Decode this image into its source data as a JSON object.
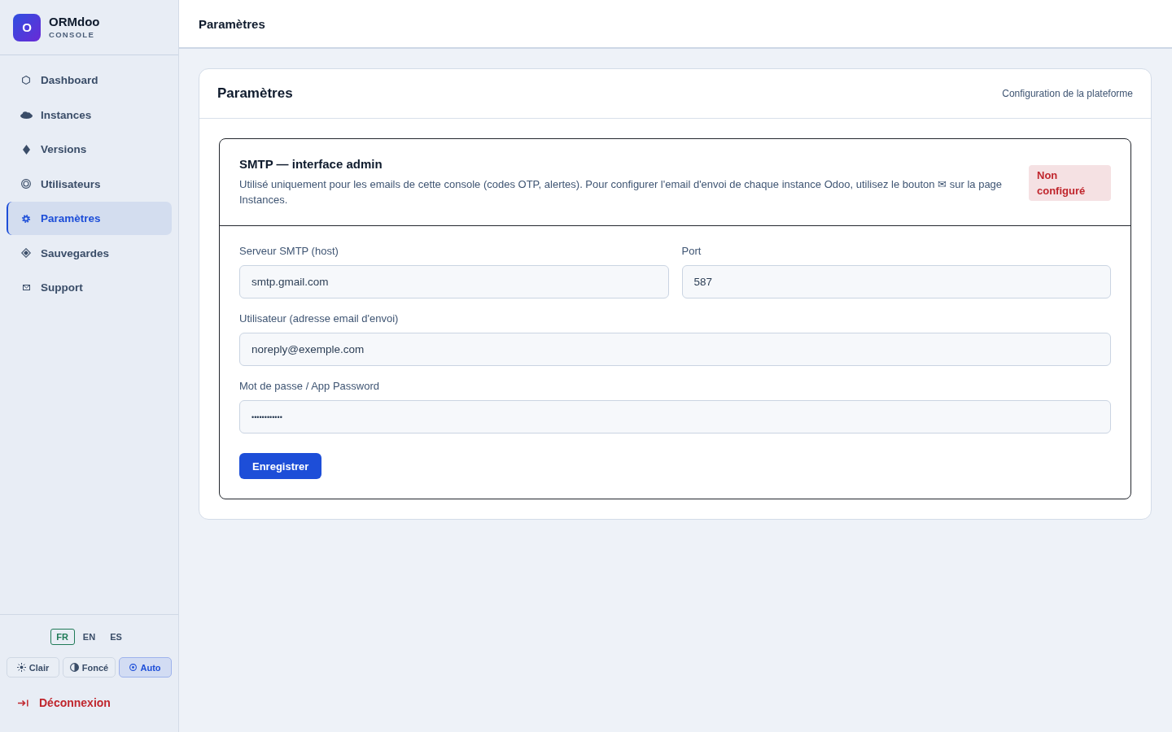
{
  "sidebar": {
    "brand": {
      "logo_letter": "O",
      "name": "ORMdoo",
      "subtitle": "CONSOLE"
    },
    "items": [
      {
        "label": "Dashboard",
        "selected": false
      },
      {
        "label": "Instances",
        "selected": false
      },
      {
        "label": "Versions",
        "selected": false
      },
      {
        "label": "Utilisateurs",
        "selected": false
      },
      {
        "label": "Paramètres",
        "selected": true
      },
      {
        "label": "Sauvegardes",
        "selected": false
      },
      {
        "label": "Support",
        "selected": false
      }
    ],
    "languages": [
      {
        "label": "FR",
        "selected": true
      },
      {
        "label": "EN",
        "selected": false
      },
      {
        "label": "ES",
        "selected": false
      }
    ],
    "themes": [
      {
        "label": "Clair",
        "selected": false
      },
      {
        "label": "Foncé",
        "selected": false
      },
      {
        "label": "Auto",
        "selected": true
      }
    ],
    "logout": {
      "label": "Déconnexion"
    }
  },
  "topbar": {
    "title": "Paramètres"
  },
  "card": {
    "title": "Paramètres",
    "subtitle": "Configuration de la plateforme",
    "section": {
      "title": "SMTP — interface admin",
      "description": "Utilisé uniquement pour les emails de cette console (codes OTP, alertes). Pour configurer l'email d'envoi de chaque instance Odoo, utilisez le bouton ✉ sur la page Instances.",
      "badge": "Non configuré",
      "rows": [
        [
          {
            "label": "Serveur SMTP (host)",
            "value": "smtp.gmail.com",
            "kind": "text"
          },
          {
            "label": "Port",
            "value": "587",
            "kind": "text"
          }
        ],
        [
          {
            "label": "Utilisateur (adresse email d'envoi)",
            "value": "noreply@exemple.com",
            "kind": "text"
          }
        ],
        [
          {
            "label": "Mot de passe / App Password",
            "value": "••••••••••••",
            "kind": "password"
          }
        ]
      ],
      "button": "Enregistrer"
    }
  }
}
